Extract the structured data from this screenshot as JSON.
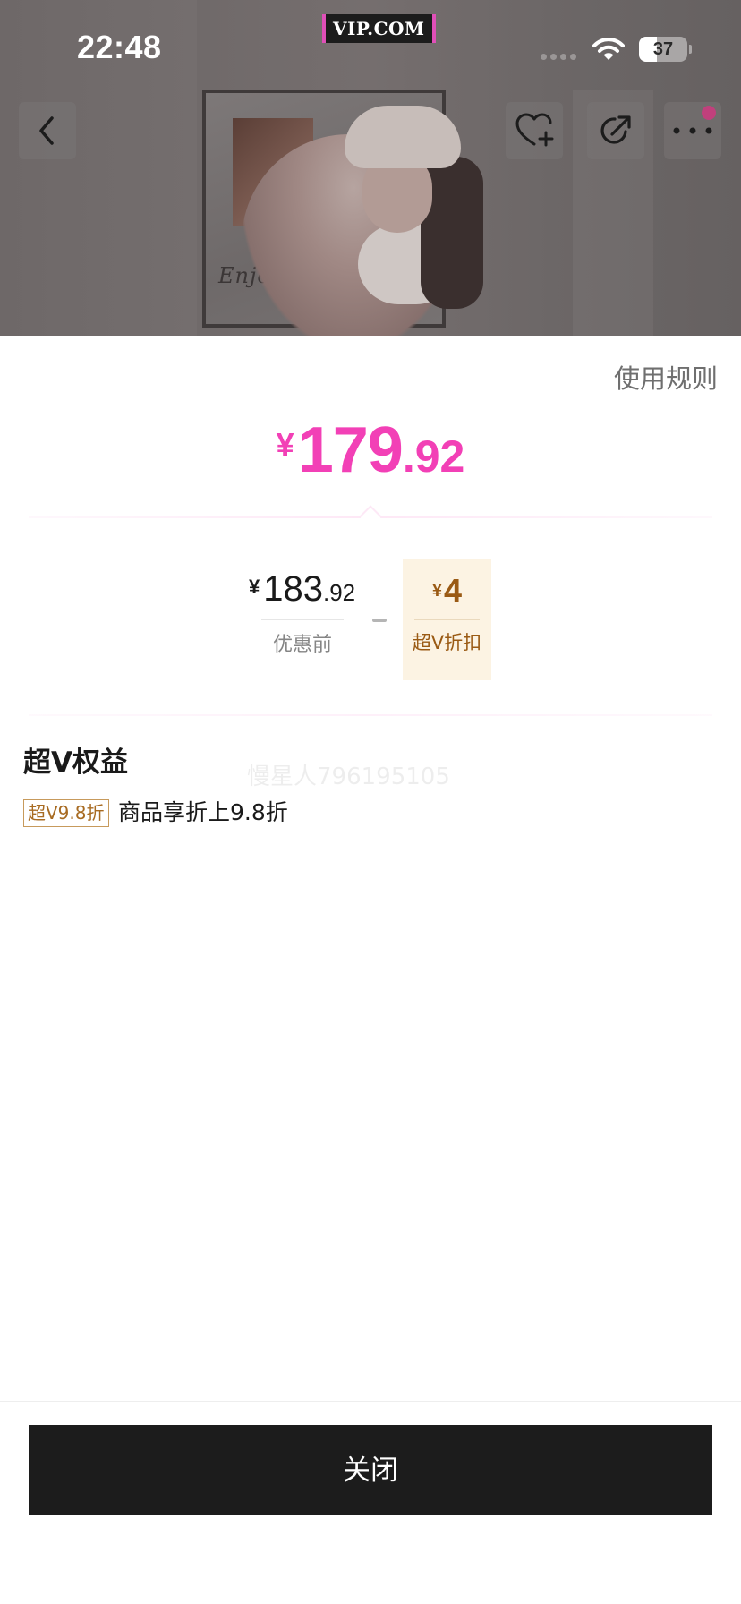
{
  "status_bar": {
    "time": "22:48",
    "brand": "VIP.COM",
    "battery_level": "37",
    "battery_fraction": 0.37
  },
  "hero": {
    "photo_script_text": "Enjoy you",
    "icons": [
      "back-icon",
      "favorite-add-icon",
      "share-icon",
      "more-icon"
    ]
  },
  "sheet": {
    "rules_link": "使用规则",
    "final_price": {
      "currency": "¥",
      "integer": "179",
      "decimal": ".92"
    },
    "original_price": {
      "currency": "¥",
      "integer": "183",
      "decimal": ".92",
      "label": "优惠前"
    },
    "operator": "−",
    "discount": {
      "currency": "¥",
      "amount": "4",
      "label": "超V折扣"
    },
    "section_title": "超V权益",
    "watermark": "慢星人796195105",
    "benefit": {
      "tag": "超V9.8折",
      "text": "商品享折上9.8折"
    },
    "close_button": "关闭"
  },
  "colors": {
    "accent_price": "#f240b6",
    "discount_text": "#9a5a14",
    "discount_bg": "#fcf3e3",
    "button_bg": "#1c1c1c"
  }
}
